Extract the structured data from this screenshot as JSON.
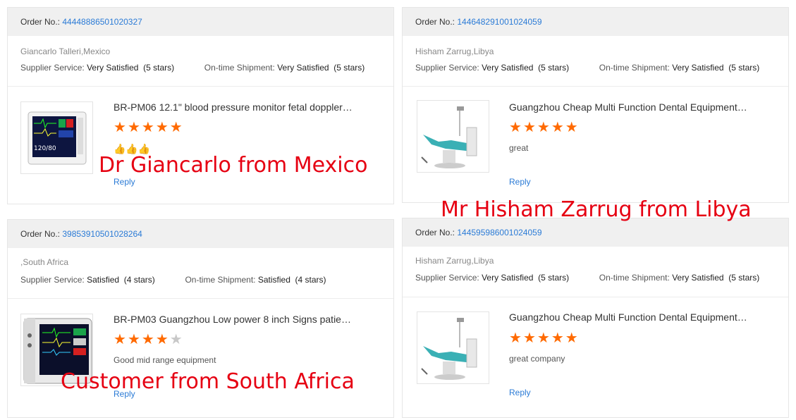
{
  "cards": [
    {
      "order_label": "Order No.:",
      "order_no": "44448886501020327",
      "buyer": "Giancarlo Talleri,Mexico",
      "supplier_label": "Supplier Service:",
      "supplier_value": "Very Satisfied  (5 stars)",
      "shipment_label": "On-time Shipment:",
      "shipment_value": "Very Satisfied  (5 stars)",
      "product_title": "BR-PM06 12.1\" blood pressure monitor fetal doppler…",
      "stars": 5,
      "comment": "👍👍👍",
      "reply": "Reply"
    },
    {
      "order_label": "Order No.:",
      "order_no": "144648291001024059",
      "buyer": "Hisham Zarrug,Libya",
      "supplier_label": "Supplier Service:",
      "supplier_value": "Very Satisfied  (5 stars)",
      "shipment_label": "On-time Shipment:",
      "shipment_value": "Very Satisfied  (5 stars)",
      "product_title": "Guangzhou Cheap Multi Function Dental Equipment…",
      "stars": 5,
      "comment": "great",
      "reply": "Reply"
    },
    {
      "order_label": "Order No.:",
      "order_no": "39853910501028264",
      "buyer": ",South Africa",
      "supplier_label": "Supplier Service:",
      "supplier_value": "Satisfied  (4 stars)",
      "shipment_label": "On-time Shipment:",
      "shipment_value": "Satisfied  (4 stars)",
      "product_title": "BR-PM03 Guangzhou Low power 8 inch Signs patie…",
      "stars": 4,
      "comment": "Good mid range equipment",
      "reply": "Reply"
    },
    {
      "order_label": "Order No.:",
      "order_no": "144595986001024059",
      "buyer": "Hisham Zarrug,Libya",
      "supplier_label": "Supplier Service:",
      "supplier_value": "Very Satisfied  (5 stars)",
      "shipment_label": "On-time Shipment:",
      "shipment_value": "Very Satisfied  (5 stars)",
      "product_title": "Guangzhou Cheap Multi Function Dental Equipment…",
      "stars": 5,
      "comment": "great company",
      "reply": "Reply"
    }
  ],
  "overlays": {
    "mexico": "Dr Giancarlo from Mexico",
    "libya": "Mr Hisham Zarrug from Libya",
    "south_africa": "Customer from South Africa"
  },
  "monitor_screen_text": "120/80",
  "colors": {
    "star_active": "#ff6a00",
    "star_inactive": "#c8c8c8",
    "link": "#2b7bd6",
    "overlay_text": "#e60012"
  }
}
